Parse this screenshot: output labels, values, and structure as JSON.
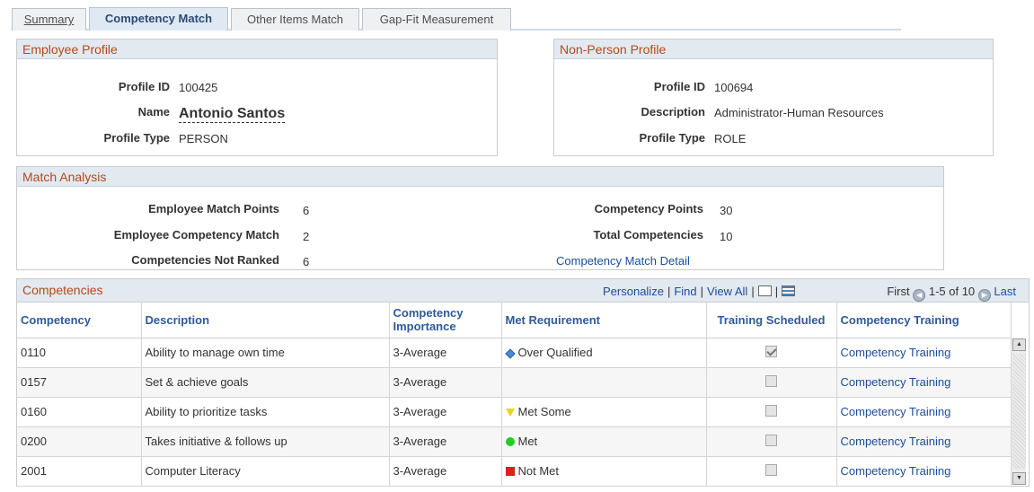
{
  "tabs": [
    {
      "label": "Summary"
    },
    {
      "label": "Competency Match"
    },
    {
      "label": "Other Items Match"
    },
    {
      "label": "Gap-Fit Measurement"
    }
  ],
  "employee_profile": {
    "title": "Employee Profile",
    "profile_id_label": "Profile ID",
    "profile_id": "100425",
    "name_label": "Name",
    "name": "Antonio Santos",
    "profile_type_label": "Profile Type",
    "profile_type": "PERSON"
  },
  "non_person_profile": {
    "title": "Non-Person Profile",
    "profile_id_label": "Profile ID",
    "profile_id": "100694",
    "description_label": "Description",
    "description": "Administrator-Human Resources",
    "profile_type_label": "Profile Type",
    "profile_type": "ROLE"
  },
  "match_analysis": {
    "title": "Match Analysis",
    "employee_match_points_label": "Employee Match Points",
    "employee_match_points": "6",
    "employee_competency_match_label": "Employee Competency Match",
    "employee_competency_match": "2",
    "competencies_not_ranked_label": "Competencies Not Ranked",
    "competencies_not_ranked": "6",
    "competency_points_label": "Competency Points",
    "competency_points": "30",
    "total_competencies_label": "Total Competencies",
    "total_competencies": "10",
    "detail_link": "Competency Match Detail"
  },
  "competencies": {
    "title": "Competencies",
    "personalize": "Personalize",
    "find": "Find",
    "view_all": "View All",
    "first": "First",
    "range": "1-5 of 10",
    "last": "Last",
    "columns": {
      "competency": "Competency",
      "description": "Description",
      "importance": "Competency Importance",
      "met_requirement": "Met Requirement",
      "training_scheduled": "Training Scheduled",
      "competency_training": "Competency Training"
    },
    "rows": [
      {
        "competency": "0110",
        "description": "Ability to manage own time",
        "importance": "3-Average",
        "met": "Over Qualified",
        "met_icon": "diamond-icon",
        "training_scheduled": true,
        "training_link": "Competency Training"
      },
      {
        "competency": "0157",
        "description": "Set & achieve goals",
        "importance": "3-Average",
        "met": "",
        "met_icon": "",
        "training_scheduled": false,
        "training_link": "Competency Training"
      },
      {
        "competency": "0160",
        "description": "Ability to prioritize tasks",
        "importance": "3-Average",
        "met": "Met Some",
        "met_icon": "triangle-icon",
        "training_scheduled": false,
        "training_link": "Competency Training"
      },
      {
        "competency": "0200",
        "description": "Takes initiative & follows up",
        "importance": "3-Average",
        "met": "Met",
        "met_icon": "circle-icon",
        "training_scheduled": false,
        "training_link": "Competency Training"
      },
      {
        "competency": "2001",
        "description": "Computer Literacy",
        "importance": "3-Average",
        "met": "Not Met",
        "met_icon": "square-icon",
        "training_scheduled": false,
        "training_link": "Competency Training"
      }
    ]
  },
  "colors": {
    "section_title": "#b24a1c",
    "link": "#1c4c9a",
    "header_bg": "#e3e9f0"
  }
}
